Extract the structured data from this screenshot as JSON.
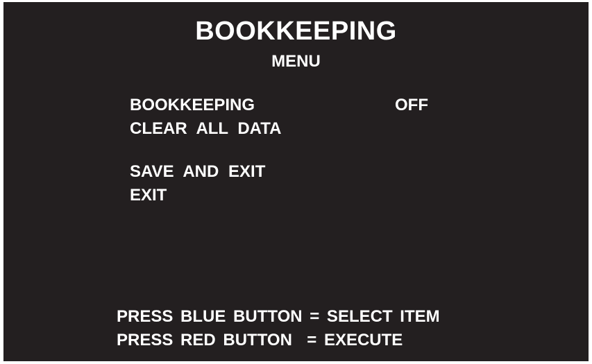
{
  "header": {
    "title": "BOOKKEEPING",
    "subtitle": "MENU"
  },
  "menu": {
    "items": [
      {
        "label": "BOOKKEEPING",
        "value": "OFF"
      },
      {
        "label": "CLEAR ALL DATA"
      },
      {
        "label": "SAVE AND EXIT"
      },
      {
        "label": "EXIT"
      }
    ]
  },
  "instructions": [
    "PRESS BLUE BUTTON = SELECT ITEM",
    "PRESS RED BUTTON  = EXECUTE"
  ],
  "colors": {
    "background": "#231f20",
    "text": "#ffffff"
  }
}
